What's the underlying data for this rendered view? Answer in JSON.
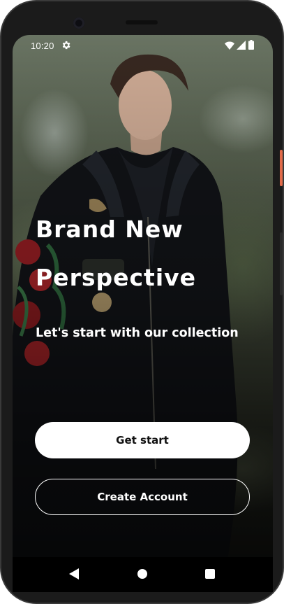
{
  "status_bar": {
    "time": "10:20",
    "icons": [
      "settings-icon",
      "wifi-icon",
      "signal-icon",
      "battery-icon"
    ]
  },
  "hero": {
    "headline_line1": "Brand New",
    "headline_line2": "Perspective",
    "subtitle": "Let's start with our collection"
  },
  "actions": {
    "primary_label": "Get start",
    "secondary_label": "Create Account"
  },
  "navigation": {
    "icons": [
      "back-icon",
      "home-icon",
      "recents-icon"
    ]
  },
  "colors": {
    "text": "#ffffff",
    "primary_button_bg": "#ffffff",
    "primary_button_text": "#111111",
    "nav_bar": "#000000",
    "power_button": "#e36b4a"
  }
}
